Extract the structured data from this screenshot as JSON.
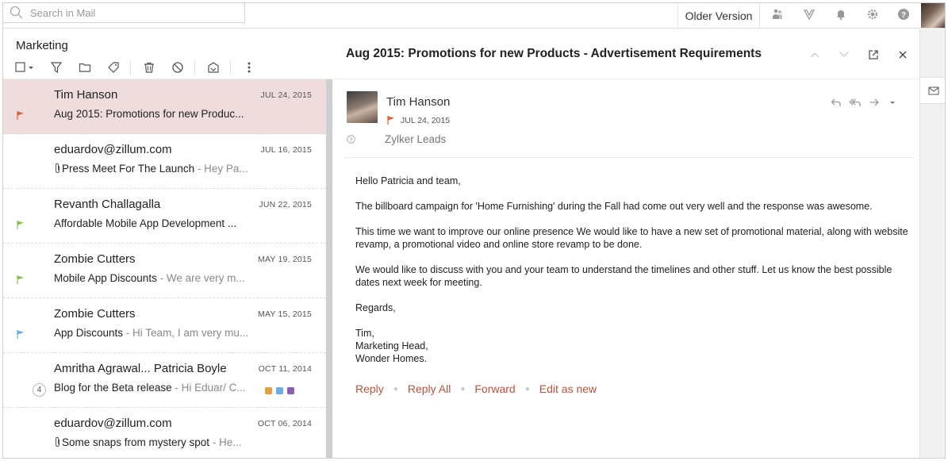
{
  "search": {
    "placeholder": "Search in Mail"
  },
  "topbar": {
    "older_version": "Older Version",
    "icons": [
      "people-icon",
      "v-logo-icon",
      "bell-icon",
      "gear-icon",
      "help-icon"
    ]
  },
  "folder": {
    "title": "Marketing"
  },
  "toolbar_icons": [
    "select-checkbox-icon",
    "filter-icon",
    "folder-icon",
    "tag-icon",
    "trash-icon",
    "block-icon",
    "archive-icon",
    "more-icon"
  ],
  "emails": [
    {
      "from": "Tim Hanson",
      "date": "JUL 24, 2015",
      "subject": "Aug 2015: Promotions for new Produc...",
      "preview": "",
      "flag": "#e0603a",
      "attachment": false,
      "selected": true
    },
    {
      "from": "eduardov@zillum.com",
      "date": "JUL 16, 2015",
      "subject": "Press Meet For The Launch",
      "preview": " - Hey Pa...",
      "flag": "",
      "attachment": true,
      "selected": false
    },
    {
      "from": "Revanth Challagalla",
      "date": "JUN 22, 2015",
      "subject": "Affordable Mobile App Development ...",
      "preview": "",
      "flag": "#8cc152",
      "attachment": false,
      "selected": false
    },
    {
      "from": "Zombie Cutters",
      "date": "MAY 19, 2015",
      "subject": "Mobile App Discounts",
      "preview": " - We are very m...",
      "flag": "#8cc152",
      "attachment": false,
      "selected": false
    },
    {
      "from": "Zombie Cutters",
      "date": "MAY 15, 2015",
      "subject": "App Discounts",
      "preview": " - Hi Team, I am very mu...",
      "flag": "#6aaee5",
      "attachment": false,
      "selected": false
    },
    {
      "from": "Amritha Agrawal... Patricia Boyle",
      "date": "OCT 11, 2014",
      "subject": "Blog for the Beta release",
      "preview": " - Hi Eduar/ C...",
      "flag": "",
      "count": "4",
      "attachment": false,
      "selected": false,
      "tags": [
        "#e0a040",
        "#6aaee5",
        "#8a5fb0"
      ]
    },
    {
      "from": "eduardov@zillum.com",
      "date": "OCT 06, 2014",
      "subject": "Some snaps from mystery spot",
      "preview": " - He...",
      "flag": "",
      "attachment": true,
      "selected": false
    }
  ],
  "message": {
    "subject": "Aug 2015: Promotions for new Products - Advertisement Requirements",
    "sender": "Tim Hanson",
    "date": "JUL 24, 2015",
    "flag": "#e0603a",
    "to": "Zylker Leads",
    "body": [
      "Hello Patricia and team,",
      "The billboard campaign for 'Home Furnishing' during the Fall had come out very well and the response was awesome.",
      "This time we want to improve our online presence We would like to have a new set of promotional material, along with website revamp, a promotional video and online store revamp to be done.",
      "We would like to discuss with you and your team to understand the timelines and other stuff. Let us know the best possible dates next week for meeting.",
      "Regards,",
      "Tim,\nMarketing Head,\nWonder Homes."
    ],
    "actions": [
      "Reply",
      "Reply All",
      "Forward",
      "Edit as new"
    ]
  },
  "colors": {
    "selected_row": "#efdcdc",
    "action_link": "#b8543c"
  }
}
